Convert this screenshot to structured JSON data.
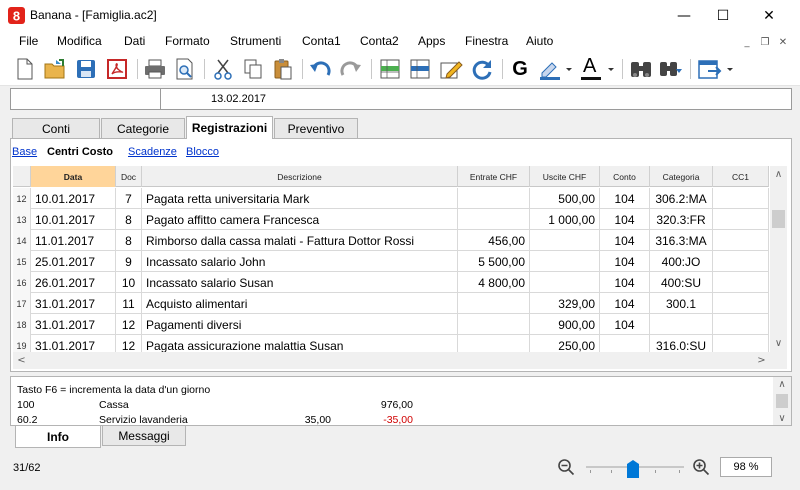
{
  "window": {
    "title": "Banana - [Famiglia.ac2]",
    "minimize_glyph": "—",
    "maximize_glyph": "☐",
    "close_glyph": "✕"
  },
  "menu": [
    "File",
    "Modifica",
    "Dati",
    "Formato",
    "Strumenti",
    "Conta1",
    "Conta2",
    "Apps",
    "Finestra",
    "Aiuto"
  ],
  "mdi": {
    "min": "_",
    "restore": "❐",
    "close": "✕"
  },
  "toolbar": {
    "icons": [
      "new-file-icon",
      "open-folder-icon",
      "save-icon",
      "pdf-icon",
      "print-icon",
      "print-preview-icon",
      "cut-icon",
      "copy-icon",
      "paste-icon",
      "undo-icon",
      "redo-icon",
      "insert-row-icon",
      "delete-row-icon",
      "edit-icon",
      "recalculate-icon",
      "bold-icon",
      "highlight-icon",
      "font-color-icon",
      "find-icon",
      "find-next-icon",
      "export-icon"
    ],
    "bold_label": "G",
    "font_color_label": "A"
  },
  "address": {
    "cell": "",
    "value": "13.02.2017"
  },
  "tabs": [
    {
      "label": "Conti"
    },
    {
      "label": "Categorie"
    },
    {
      "label": "Registrazioni",
      "active": true
    },
    {
      "label": "Preventivo"
    }
  ],
  "views": [
    {
      "label": "Base"
    },
    {
      "label": "Centri Costo",
      "active": true
    },
    {
      "label": "Scadenze"
    },
    {
      "label": "Blocco"
    }
  ],
  "grid": {
    "columns": [
      "Data",
      "Doc",
      "Descrizione",
      "Entrate CHF",
      "Uscite CHF",
      "Conto",
      "Categoria",
      "CC1"
    ],
    "selected_column": "Data",
    "rows": [
      {
        "n": "12",
        "data": "10.01.2017",
        "doc": "7",
        "desc": "Pagata retta universitaria Mark",
        "entrate": "",
        "uscite": "500,00",
        "conto": "104",
        "categoria": "306.2:MA",
        "cc1": ""
      },
      {
        "n": "13",
        "data": "10.01.2017",
        "doc": "8",
        "desc": "Pagato affitto camera Francesca",
        "entrate": "",
        "uscite": "1 000,00",
        "conto": "104",
        "categoria": "320.3:FR",
        "cc1": ""
      },
      {
        "n": "14",
        "data": "11.01.2017",
        "doc": "8",
        "desc": "Rimborso dalla cassa malati  - Fattura Dottor Rossi",
        "entrate": "456,00",
        "uscite": "",
        "conto": "104",
        "categoria": "316.3:MA",
        "cc1": ""
      },
      {
        "n": "15",
        "data": "25.01.2017",
        "doc": "9",
        "desc": "Incassato salario John",
        "entrate": "5 500,00",
        "uscite": "",
        "conto": "104",
        "categoria": "400:JO",
        "cc1": ""
      },
      {
        "n": "16",
        "data": "26.01.2017",
        "doc": "10",
        "desc": "Incassato salario Susan",
        "entrate": "4 800,00",
        "uscite": "",
        "conto": "104",
        "categoria": "400:SU",
        "cc1": ""
      },
      {
        "n": "17",
        "data": "31.01.2017",
        "doc": "11",
        "desc": "Acquisto alimentari",
        "entrate": "",
        "uscite": "329,00",
        "conto": "104",
        "categoria": "300.1",
        "cc1": ""
      },
      {
        "n": "18",
        "data": "31.01.2017",
        "doc": "12",
        "desc": "Pagamenti diversi",
        "entrate": "",
        "uscite": "900,00",
        "conto": "104",
        "categoria": "",
        "cc1": ""
      },
      {
        "n": "19",
        "data": "31.01.2017",
        "doc": "12",
        "desc": "Pagata assicurazione malattia Susan",
        "entrate": "",
        "uscite": "250,00",
        "conto": "",
        "categoria": "316.0:SU",
        "cc1": ""
      }
    ]
  },
  "info": {
    "hint": "Tasto F6 = incrementa la data d'un giorno",
    "lines": [
      {
        "code": "100",
        "name": "Cassa",
        "amount": "",
        "balance": "976,00"
      },
      {
        "code": "60.2",
        "name": "Servizio lavanderia",
        "amount": "35,00",
        "balance": "-35,00"
      }
    ],
    "negative_color": "#d00000"
  },
  "bottom_tabs": [
    {
      "label": "Info",
      "active": true
    },
    {
      "label": "Messaggi"
    }
  ],
  "status": {
    "count": "31/62",
    "zoom": "98  %",
    "zoom_level_percent": 98
  }
}
